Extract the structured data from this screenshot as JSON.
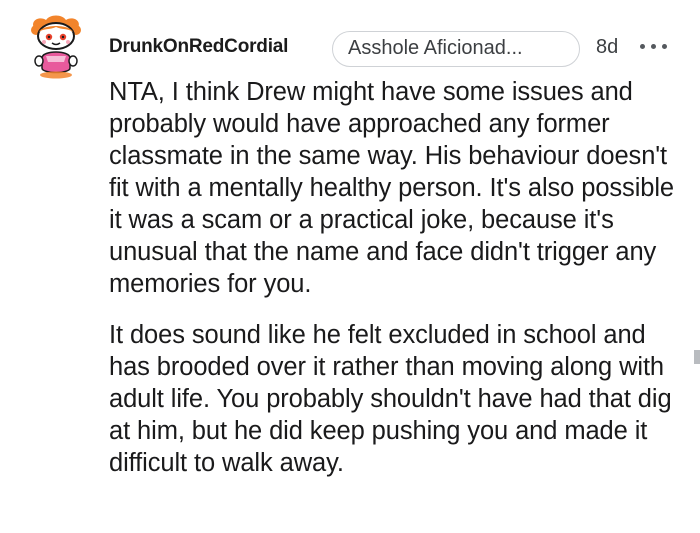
{
  "comment": {
    "username": "DrunkOnRedCordial",
    "flair": "Asshole Aficionad...",
    "time_ago": "8d",
    "more_icon": "more-horizontal-icon",
    "avatar_icon": "snoo-avatar-icon",
    "paragraphs": [
      "NTA, I think Drew might have some issues and probably would have approached any former classmate in the same way. His behaviour doesn't fit with a mentally healthy person. It's also possible it was a scam or a practical joke, because it's unusual that the name and face didn't trigger any memories for you.",
      "It does sound like he felt excluded in school and has brooded over it rather than moving along with adult life. You probably shouldn't have had that dig at him, but he did keep pushing you and made it difficult to walk away."
    ]
  },
  "colors": {
    "text": "#1a1a1b",
    "meta": "#3c3f42",
    "flair_border": "#cfd2d6",
    "avatar_orange": "#f2842b",
    "avatar_pink": "#e85a9c"
  }
}
